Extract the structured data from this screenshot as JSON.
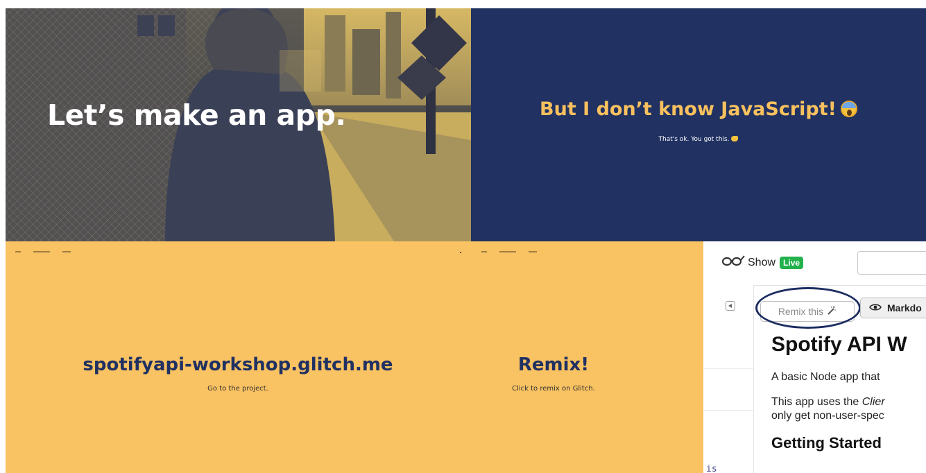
{
  "slides": {
    "photo": {
      "headline": "Let’s make an app."
    },
    "navy": {
      "headline": "But I don’t know JavaScript!",
      "headline_emoji": "scream-emoji",
      "subtitle": "That's ok. You got this.",
      "subtitle_emoji": "flexed-bicep-emoji"
    },
    "yellow": {
      "project": {
        "title": "spotifyapi-workshop.glitch.me",
        "caption": "Go to the project."
      },
      "remix": {
        "title": "Remix!",
        "caption": "Click to remix on Glitch."
      }
    }
  },
  "editor": {
    "show_label": "Show",
    "live_badge": "Live",
    "remix_label": "Remix this",
    "markdown_label": "Markdo",
    "readme": {
      "title": "Spotify API W",
      "para1": "A basic Node app that",
      "para2_line1_prefix": "This app uses the ",
      "para2_line1_italic": "Clier",
      "para2_line2": "only get non-user-spec",
      "heading2": "Getting Started"
    },
    "code_fragment": "is"
  },
  "colors": {
    "navy": "#203162",
    "gold": "#f9c15e",
    "yellow": "#f9c262",
    "live_green": "#22b14c",
    "highlight_circle": "#1d2e62"
  }
}
